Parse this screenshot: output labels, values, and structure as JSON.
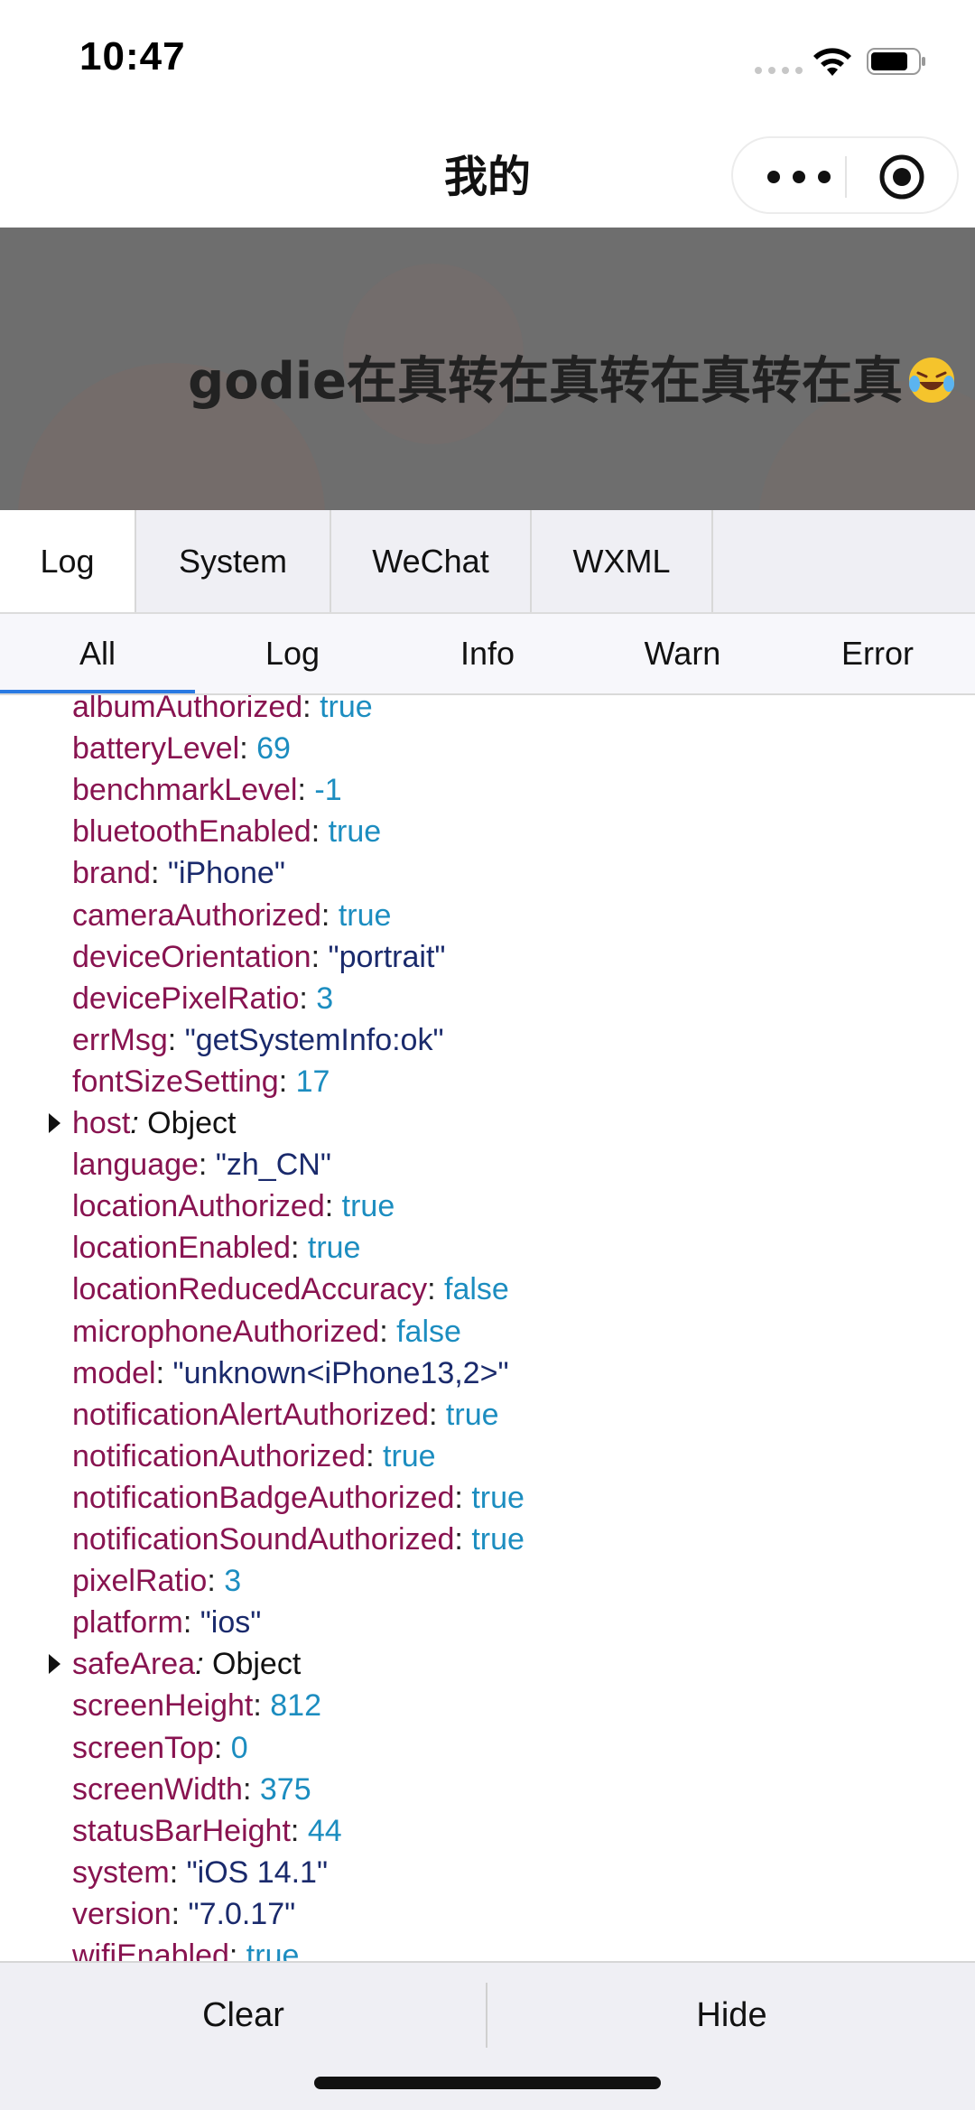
{
  "status_bar": {
    "time": "10:47"
  },
  "nav": {
    "title": "我的"
  },
  "banner": {
    "text": "godie在真转在真转在真转在真"
  },
  "tabs": [
    "Log",
    "System",
    "WeChat",
    "WXML"
  ],
  "subtabs": [
    "All",
    "Log",
    "Info",
    "Warn",
    "Error"
  ],
  "log_rows": [
    {
      "key": "albumAuthorized",
      "value": "true",
      "type": "bool"
    },
    {
      "key": "batteryLevel",
      "value": "69",
      "type": "num"
    },
    {
      "key": "benchmarkLevel",
      "value": "-1",
      "type": "num"
    },
    {
      "key": "bluetoothEnabled",
      "value": "true",
      "type": "bool"
    },
    {
      "key": "brand",
      "value": "\"iPhone\"",
      "type": "str"
    },
    {
      "key": "cameraAuthorized",
      "value": "true",
      "type": "bool"
    },
    {
      "key": "deviceOrientation",
      "value": "\"portrait\"",
      "type": "str"
    },
    {
      "key": "devicePixelRatio",
      "value": "3",
      "type": "num"
    },
    {
      "key": "errMsg",
      "value": "\"getSystemInfo:ok\"",
      "type": "str"
    },
    {
      "key": "fontSizeSetting",
      "value": "17",
      "type": "num"
    },
    {
      "key": "host",
      "value": "Object",
      "type": "obj"
    },
    {
      "key": "language",
      "value": "\"zh_CN\"",
      "type": "str"
    },
    {
      "key": "locationAuthorized",
      "value": "true",
      "type": "bool"
    },
    {
      "key": "locationEnabled",
      "value": "true",
      "type": "bool"
    },
    {
      "key": "locationReducedAccuracy",
      "value": "false",
      "type": "bool"
    },
    {
      "key": "microphoneAuthorized",
      "value": "false",
      "type": "bool"
    },
    {
      "key": "model",
      "value": "\"unknown<iPhone13,2>\"",
      "type": "str"
    },
    {
      "key": "notificationAlertAuthorized",
      "value": "true",
      "type": "bool"
    },
    {
      "key": "notificationAuthorized",
      "value": "true",
      "type": "bool"
    },
    {
      "key": "notificationBadgeAuthorized",
      "value": "true",
      "type": "bool"
    },
    {
      "key": "notificationSoundAuthorized",
      "value": "true",
      "type": "bool"
    },
    {
      "key": "pixelRatio",
      "value": "3",
      "type": "num"
    },
    {
      "key": "platform",
      "value": "\"ios\"",
      "type": "str"
    },
    {
      "key": "safeArea",
      "value": "Object",
      "type": "obj"
    },
    {
      "key": "screenHeight",
      "value": "812",
      "type": "num"
    },
    {
      "key": "screenTop",
      "value": "0",
      "type": "num"
    },
    {
      "key": "screenWidth",
      "value": "375",
      "type": "num"
    },
    {
      "key": "statusBarHeight",
      "value": "44",
      "type": "num"
    },
    {
      "key": "system",
      "value": "\"iOS 14.1\"",
      "type": "str"
    },
    {
      "key": "version",
      "value": "\"7.0.17\"",
      "type": "str"
    },
    {
      "key": "wifiEnabled",
      "value": "true",
      "type": "bool"
    }
  ],
  "bottom": {
    "clear_label": "Clear",
    "hide_label": "Hide"
  }
}
